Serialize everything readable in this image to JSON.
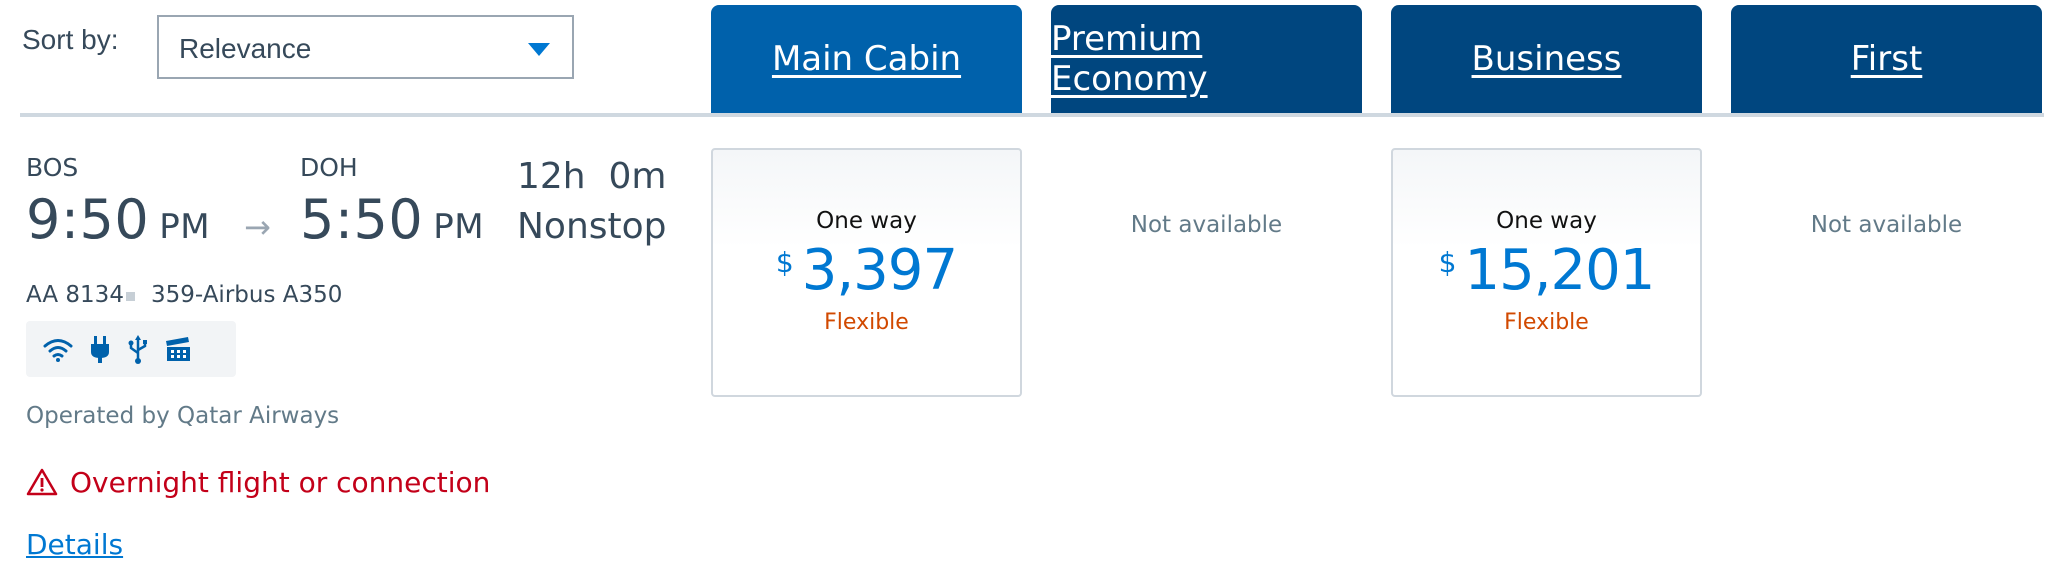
{
  "sort": {
    "label": "Sort by:",
    "selected": "Relevance"
  },
  "cabins": {
    "main": "Main Cabin",
    "premium_economy": "Premium Economy",
    "business": "Business",
    "first": "First"
  },
  "flight": {
    "origin": "BOS",
    "destination": "DOH",
    "depart_time": "9:50",
    "depart_ampm": "PM",
    "arrive_time": "5:50",
    "arrive_ampm": "PM",
    "arrow": "→",
    "duration": "12h  0m",
    "stops": "Nonstop",
    "flight_number": "AA 8134",
    "aircraft": "359-Airbus A350",
    "amenities": [
      "wifi-icon",
      "power-outlet-icon",
      "usb-icon",
      "entertainment-icon"
    ],
    "operated_by": "Operated by Qatar Airways",
    "overnight_warning": "Overnight flight or connection",
    "details_link": "Details"
  },
  "fares": {
    "main": {
      "trip": "One way",
      "currency": "$",
      "price": "3,397",
      "type": "Flexible"
    },
    "premium_economy": {
      "status": "Not available"
    },
    "business": {
      "trip": "One way",
      "currency": "$",
      "price": "15,201",
      "type": "Flexible"
    },
    "first": {
      "status": "Not available"
    }
  },
  "colors": {
    "accent_blue": "#0078d2",
    "tab_active": "#0061ab",
    "tab_inactive": "#00467f",
    "warning_red": "#c30019",
    "fare_type_orange": "#d14900"
  }
}
